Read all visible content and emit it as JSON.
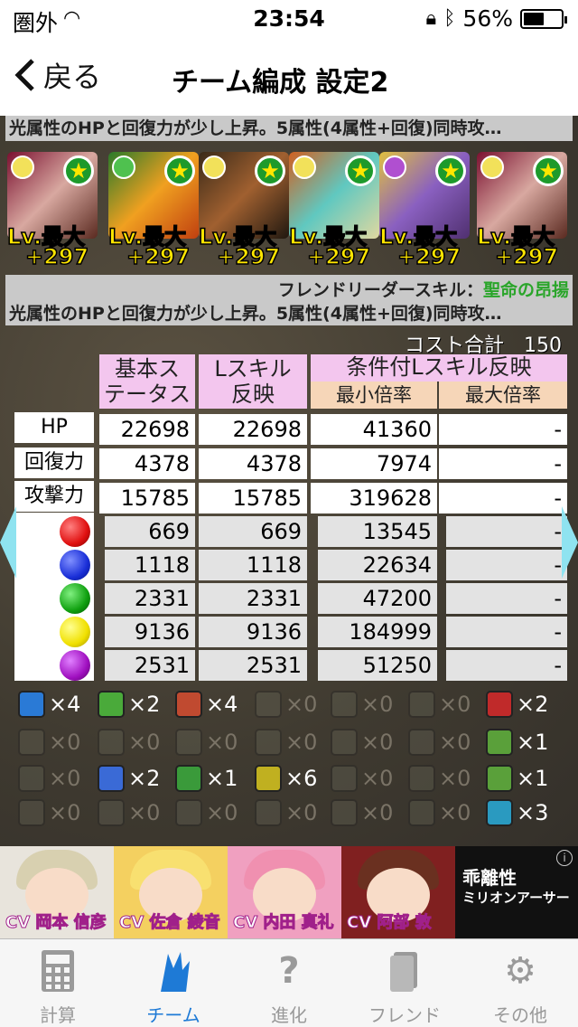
{
  "status": {
    "carrier": "圏外",
    "time": "23:54",
    "battery": "56%",
    "battery_level": 0.56
  },
  "nav": {
    "back": "戻る",
    "title": "チーム編成 設定2"
  },
  "leader_skill_text": "光属性のHPと回復力が少し上昇。5属性(4属性+回復)同時攻…",
  "team": [
    {
      "lv": "Lv.最大",
      "plus": "+297",
      "attr": "#f2e15a"
    },
    {
      "lv": "Lv.最大",
      "plus": "+297",
      "attr": "#4fc14f"
    },
    {
      "lv": "Lv.最大",
      "plus": "+297",
      "attr": "#f2e15a"
    },
    {
      "lv": "Lv.最大",
      "plus": "+297",
      "attr": "#f2e15a"
    },
    {
      "lv": "Lv.最大",
      "plus": "+297",
      "attr": "#b04fd0"
    },
    {
      "lv": "Lv.最大",
      "plus": "+297",
      "attr": "#f2e15a"
    }
  ],
  "friend": {
    "label": "フレンドリーダースキル：",
    "skill": "聖命の昂揚",
    "text": "光属性のHPと回復力が少し上昇。5属性(4属性+回復)同時攻…"
  },
  "cost": {
    "label": "コスト合計",
    "value": "150"
  },
  "headers": {
    "base_l1": "基本ス",
    "base_l2": "テータス",
    "lskill_l1": "Lスキル",
    "lskill_l2": "反映",
    "cond": "条件付Lスキル反映",
    "min": "最小倍率",
    "max": "最大倍率"
  },
  "rows": [
    {
      "label": "HP",
      "base": "22698",
      "lskill": "22698",
      "min": "41360",
      "max": "-"
    },
    {
      "label": "回復力",
      "base": "4378",
      "lskill": "4378",
      "min": "7974",
      "max": "-"
    },
    {
      "label": "攻撃力",
      "base": "15785",
      "lskill": "15785",
      "min": "319628",
      "max": "-"
    }
  ],
  "attack_rows": [
    {
      "color": "#e01010",
      "base": "669",
      "lskill": "669",
      "min": "13545",
      "max": "-"
    },
    {
      "color": "#1a2fd8",
      "base": "1118",
      "lskill": "1118",
      "min": "22634",
      "max": "-"
    },
    {
      "color": "#10a010",
      "base": "2331",
      "lskill": "2331",
      "min": "47200",
      "max": "-"
    },
    {
      "color": "#f0e000",
      "base": "9136",
      "lskill": "9136",
      "min": "184999",
      "max": "-"
    },
    {
      "color": "#a010c0",
      "base": "2531",
      "lskill": "2531",
      "min": "51250",
      "max": "-"
    }
  ],
  "awakenings": [
    [
      "×4",
      "×2",
      "×4",
      "×0",
      "×0",
      "×0",
      "×2"
    ],
    [
      "×0",
      "×0",
      "×0",
      "×0",
      "×0",
      "×0",
      "×1"
    ],
    [
      "×0",
      "×2",
      "×1",
      "×6",
      "×0",
      "×0",
      "×1"
    ],
    [
      "×0",
      "×0",
      "×0",
      "×0",
      "×0",
      "×0",
      "×3"
    ]
  ],
  "banner": {
    "cv": [
      "CV 岡本 信彦",
      "CV 佐倉 綾音",
      "CV 内田 真礼",
      "CV 阿部 敦"
    ],
    "title_l1": "乖離性",
    "title_l2": "ミリオンアーサー",
    "info": "i"
  },
  "tabs": [
    "計算",
    "チーム",
    "進化",
    "フレンド",
    "その他"
  ]
}
